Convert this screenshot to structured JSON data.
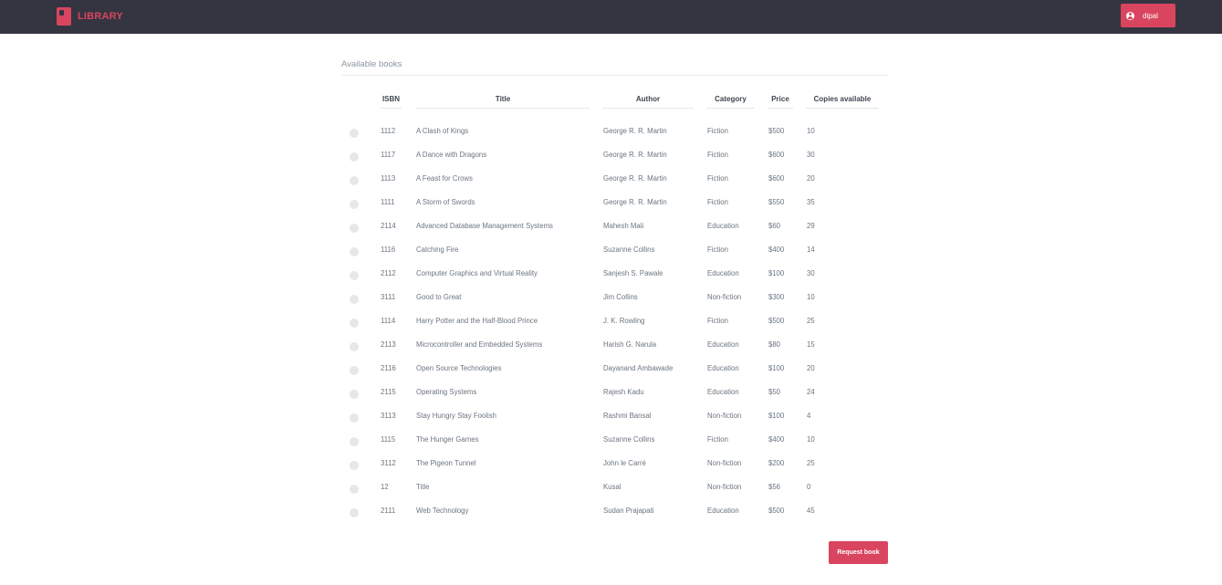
{
  "header": {
    "brand": "LIBRARY",
    "user_name": "dipal"
  },
  "section_title": "Available books",
  "columns": [
    "ISBN",
    "Title",
    "Author",
    "Category",
    "Price",
    "Copies available"
  ],
  "books": [
    {
      "isbn": "1112",
      "title": "A Clash of Kings",
      "author": "George R. R. Martin",
      "category": "Fiction",
      "price": "$500",
      "copies": "10"
    },
    {
      "isbn": "1117",
      "title": "A Dance with Dragons",
      "author": "George R. R. Martin",
      "category": "Fiction",
      "price": "$600",
      "copies": "30"
    },
    {
      "isbn": "1113",
      "title": "A Feast for Crows",
      "author": "George R. R. Martin",
      "category": "Fiction",
      "price": "$600",
      "copies": "20"
    },
    {
      "isbn": "1111",
      "title": "A Storm of Swords",
      "author": "George R. R. Martin",
      "category": "Fiction",
      "price": "$550",
      "copies": "35"
    },
    {
      "isbn": "2114",
      "title": "Advanced Database Management Systems",
      "author": "Mahesh Mali",
      "category": "Education",
      "price": "$60",
      "copies": "29"
    },
    {
      "isbn": "1116",
      "title": "Catching Fire",
      "author": "Suzanne Collins",
      "category": "Fiction",
      "price": "$400",
      "copies": "14"
    },
    {
      "isbn": "2112",
      "title": "Computer Graphics and Virtual Reality",
      "author": "Sanjesh S. Pawale",
      "category": "Education",
      "price": "$100",
      "copies": "30"
    },
    {
      "isbn": "3111",
      "title": "Good to Great",
      "author": "Jim Collins",
      "category": "Non-fiction",
      "price": "$300",
      "copies": "10"
    },
    {
      "isbn": "1114",
      "title": "Harry Potter and the Half-Blood Prince",
      "author": "J. K. Rowling",
      "category": "Fiction",
      "price": "$500",
      "copies": "25"
    },
    {
      "isbn": "2113",
      "title": "Microcontroller and Embedded Systems",
      "author": "Harish G. Narula",
      "category": "Education",
      "price": "$80",
      "copies": "15"
    },
    {
      "isbn": "2116",
      "title": "Open Source Technologies",
      "author": "Dayanand Ambawade",
      "category": "Education",
      "price": "$100",
      "copies": "20"
    },
    {
      "isbn": "2115",
      "title": "Operating Systems",
      "author": "Rajesh Kadu",
      "category": "Education",
      "price": "$50",
      "copies": "24"
    },
    {
      "isbn": "3113",
      "title": "Stay Hungry Stay Foolish",
      "author": "Rashmi Bansal",
      "category": "Non-fiction",
      "price": "$100",
      "copies": "4"
    },
    {
      "isbn": "1115",
      "title": "The Hunger Games",
      "author": "Suzanne Collins",
      "category": "Fiction",
      "price": "$400",
      "copies": "10"
    },
    {
      "isbn": "3112",
      "title": "The Pigeon Tunnel",
      "author": "John le Carré",
      "category": "Non-fiction",
      "price": "$200",
      "copies": "25"
    },
    {
      "isbn": "12",
      "title": "Title",
      "author": "Kusal",
      "category": "Non-fiction",
      "price": "$56",
      "copies": "0"
    },
    {
      "isbn": "2111",
      "title": "Web Technology",
      "author": "Sudan Prajapati",
      "category": "Education",
      "price": "$500",
      "copies": "45"
    }
  ],
  "request_button": "Request book",
  "colors": {
    "topbar": "#343541",
    "accent": "#d9455f"
  },
  "icons": {
    "brand": "book-icon",
    "user": "user-circle-icon"
  }
}
